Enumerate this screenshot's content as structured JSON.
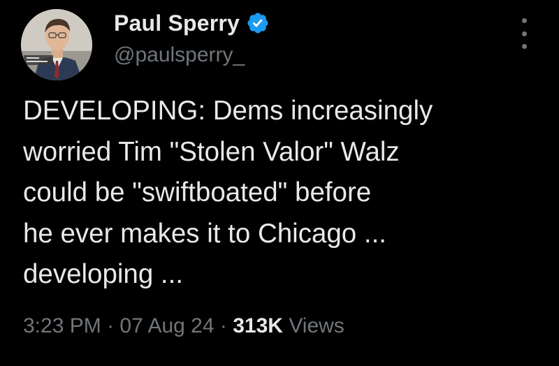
{
  "author": {
    "display_name": "Paul Sperry",
    "handle": "@paulsperry_",
    "verified_color": "#1d9bf0"
  },
  "tweet": {
    "text_lines": [
      "DEVELOPING: Dems increasingly",
      "worried Tim \"Stolen Valor\" Walz",
      "could be \"swiftboated\" before",
      "he ever makes it to Chicago ...",
      "developing ..."
    ]
  },
  "meta": {
    "time": "3:23 PM",
    "separator": "·",
    "date": "07 Aug 24",
    "views_count": "313K",
    "views_label": "Views"
  },
  "icons": {
    "verified": "verified-badge-icon",
    "more": "more-options-icon"
  }
}
